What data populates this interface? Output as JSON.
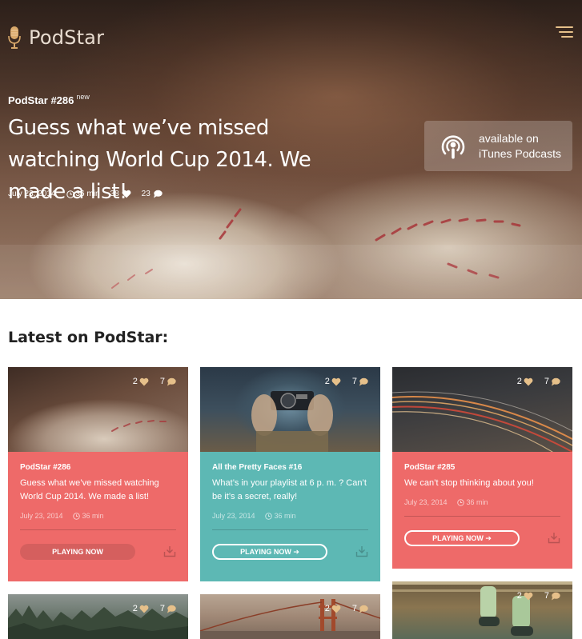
{
  "brand": {
    "name": "PodStar"
  },
  "hero": {
    "episode": "PodStar #286",
    "badge": "new",
    "title": "Guess what we’ve missed watching World Cup 2014. We made a list!",
    "date": "July 23, 2014",
    "duration": "36 min",
    "likes": "38",
    "comments": "23"
  },
  "itunes": {
    "line1": "available on",
    "line2": "iTunes Podcasts"
  },
  "section": {
    "title": "Latest on PodStar:"
  },
  "cards": [
    {
      "episode": "PodStar #286",
      "title": "Guess what we’ve missed watching World Cup 2014. We made a list!",
      "date": "July 23, 2014",
      "duration": "36 min",
      "likes": "2",
      "comments": "7",
      "button": "PLAYING NOW"
    },
    {
      "episode": "All the Pretty Faces #16",
      "title": "What’s in your playlist at 6 p. m. ? Can’t be it’s a secret, really!",
      "date": "July 23, 2014",
      "duration": "36 min",
      "likes": "2",
      "comments": "7",
      "button": "PLAYING NOW ➔"
    },
    {
      "episode": "PodStar #285",
      "title": "We can’t stop thinking about you!",
      "date": "July 23, 2014",
      "duration": "36 min",
      "likes": "2",
      "comments": "7",
      "button": "PLAYING NOW ➔"
    },
    {
      "likes": "2",
      "comments": "7"
    },
    {
      "likes": "2",
      "comments": "7"
    },
    {
      "likes": "2",
      "comments": "7"
    }
  ],
  "colors": {
    "coral": "#ee6a69",
    "teal": "#5db8b4",
    "gold": "#e6c08a"
  },
  "icons": [
    "menu-icon",
    "microphone-icon",
    "clock-icon",
    "heart-icon",
    "comment-icon",
    "podcast-icon",
    "download-icon"
  ]
}
